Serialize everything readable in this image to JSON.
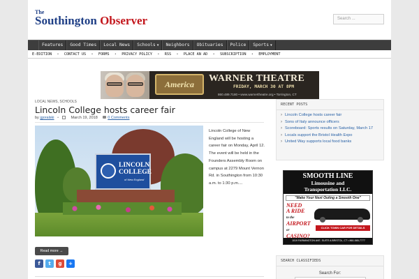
{
  "header": {
    "logo_line1": "The",
    "logo_line2a": "Southington",
    "logo_line2b": "Observer",
    "search_placeholder": "Search ..."
  },
  "main_nav": [
    {
      "label": "Features",
      "caret": false
    },
    {
      "label": "Good Times",
      "caret": false
    },
    {
      "label": "Local News",
      "caret": false
    },
    {
      "label": "Schools",
      "caret": true
    },
    {
      "label": "Neighbors",
      "caret": false
    },
    {
      "label": "Obituaries",
      "caret": false
    },
    {
      "label": "Police",
      "caret": false
    },
    {
      "label": "Sports",
      "caret": true
    }
  ],
  "sub_nav": [
    "E-EDITION",
    "CONTACT US",
    "FORMS",
    "PRIVACY POLICY",
    "RSS",
    "PLACE AN AD",
    "SUBSCRIPTION",
    "EMPLOYMENT"
  ],
  "banner": {
    "america": "America",
    "theatre": "WARNER THEATRE",
    "date": "FRIDAY, MARCH 30 AT 8PM",
    "contact": "860.489.7180 • www.warnertheatre.org • Torrington, CT"
  },
  "article": {
    "categories": "LOCAL NEWS, SCHOOLS",
    "title": "Lincoln College hosts career fair",
    "by": "by",
    "author": "jgoralski",
    "date": "March 19, 2018",
    "comments": "0 Comments",
    "excerpt": "Lincoln College of New England will be hosting a career fair on Monday, April 12. The event will be held in the Founders Assembly Room on campus at 2279 Mount Vernon Rd. in Southington from 10:30 a.m. to 1:30 p.m....",
    "sign_name1": "LINCOLN",
    "sign_name2": "COLLEGE",
    "sign_sub": "of New England",
    "read_more": "Read more →"
  },
  "share_icons": [
    "facebook-icon",
    "twitter-icon",
    "google-plus-icon",
    "share-icon"
  ],
  "sidebar": {
    "recent_title": "RECENT POSTS",
    "recent_posts": [
      "Lincoln College hosts career fair",
      "Sons of Italy announce officers",
      "Scoreboard: Sports results on Saturday, March 17",
      "Locals support the Bristol Health Expo",
      "United Way supports local food banks"
    ],
    "ad": {
      "line1": "SMOOTH LINE",
      "line2": "Limousine and",
      "line3": "Transportation LLC.",
      "slogan": "\"Make Your Next Outing a Smooth One\"",
      "need1": "NEED",
      "need2": "A RIDE",
      "need3": "to the",
      "need4": "AIRPORT",
      "need5": "or",
      "need6": "CASINO?",
      "click": "CLICK TOWN CAR FOR DETAILS",
      "address": "1019 FARMINGTON AVE. SUITE A BRISTOL, CT • 860-585-7777"
    },
    "classifieds_title": "SEARCH CLASSIFIEDS",
    "search_for": "Search For:"
  },
  "colors": {
    "nav_bg": "#3d3d3d",
    "link": "#2a62a6",
    "logo_blue": "#1f3f86",
    "logo_red": "#c3161c"
  }
}
